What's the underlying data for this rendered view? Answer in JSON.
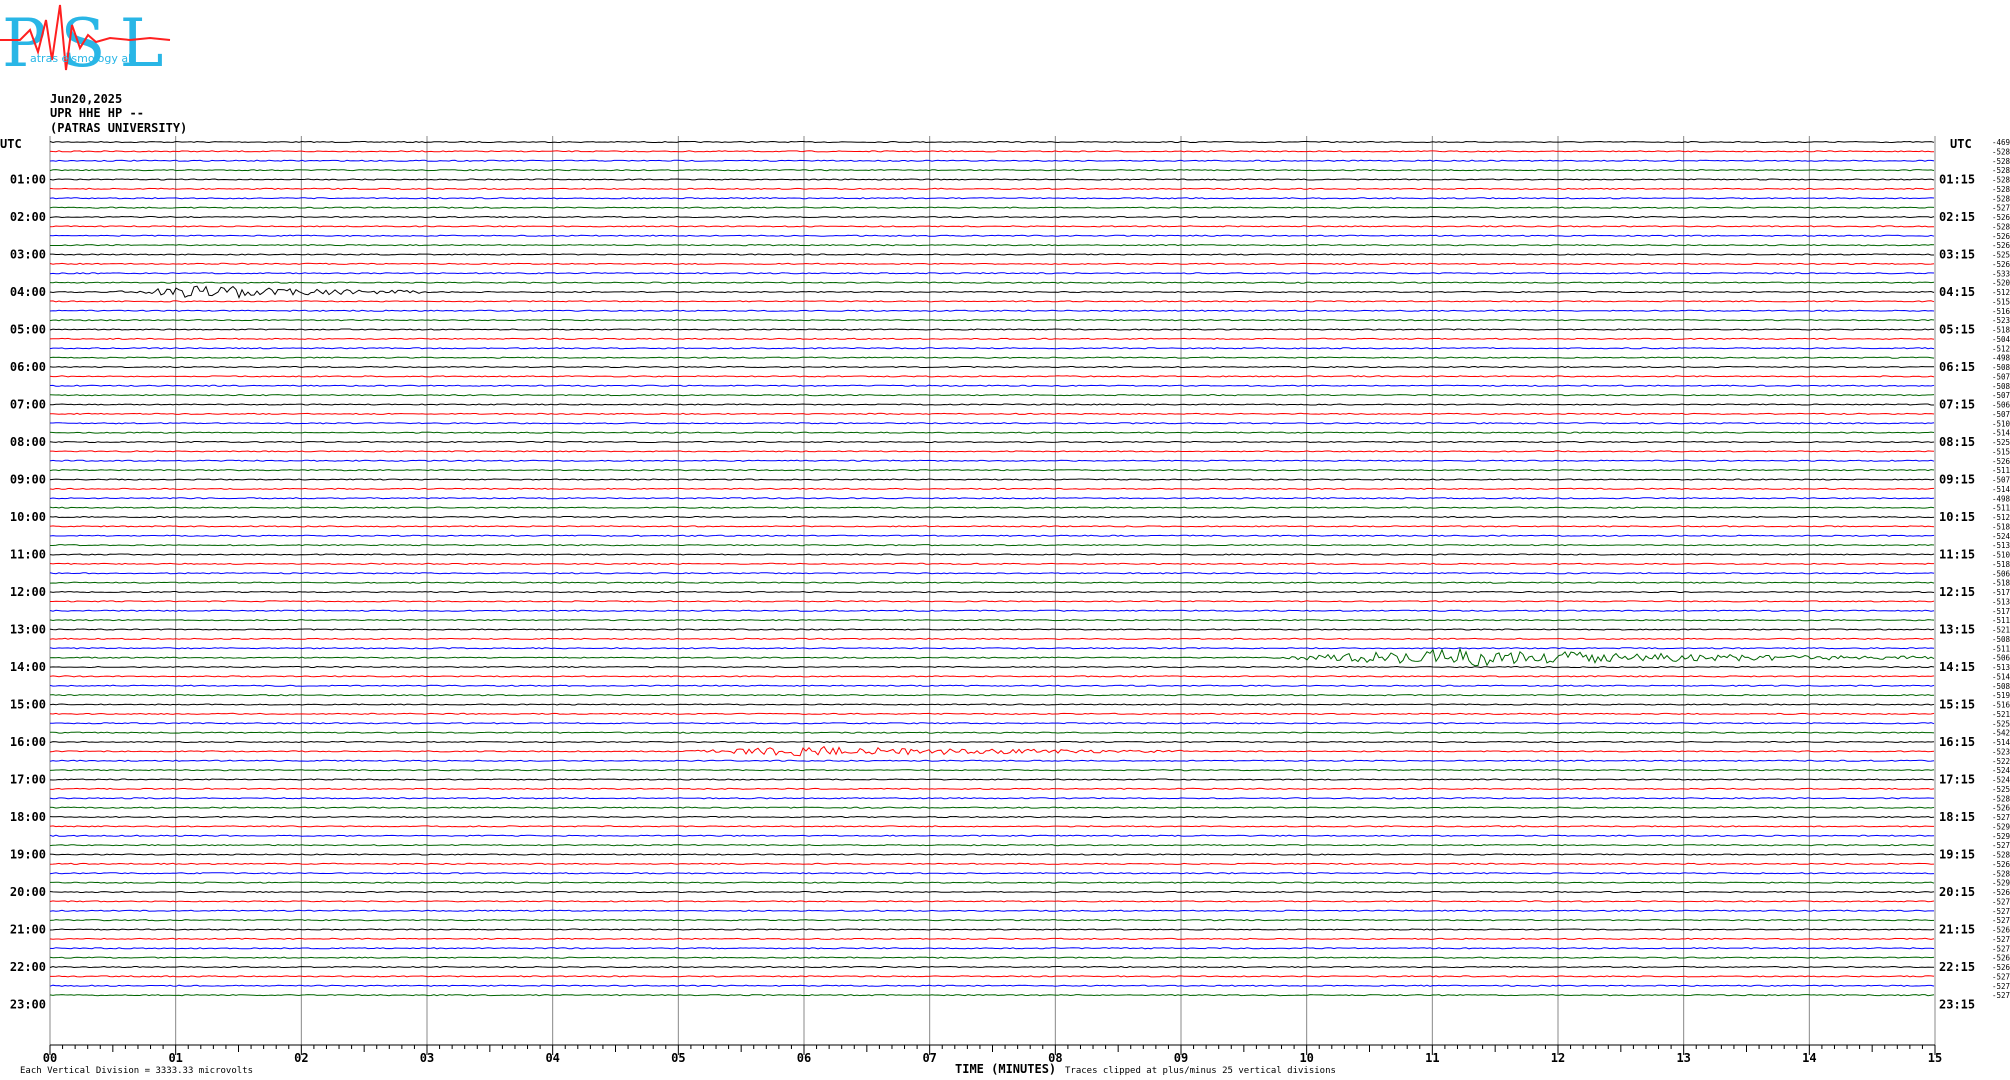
{
  "header": {
    "date": "Jun20,2025",
    "station": "UPR HHE HP --",
    "institution": "(PATRAS UNIVERSITY)",
    "logo_text": "PSL",
    "logo_sub": "atras eismology ab"
  },
  "axes": {
    "utc_left": "UTC",
    "utc_right": "UTC",
    "xlabel": "TIME (MINUTES)",
    "footer_left": "Each Vertical Division = 3333.33 microvolts",
    "footer_right": "Traces clipped at plus/minus 25 vertical divisions"
  },
  "colors": {
    "black": "#000000",
    "red": "#ff0000",
    "blue": "#0000ff",
    "green": "#006400",
    "grid": "#888888"
  },
  "chart_data": {
    "type": "line",
    "title": "",
    "x_ticks": [
      "00",
      "01",
      "02",
      "03",
      "04",
      "05",
      "06",
      "07",
      "08",
      "09",
      "10",
      "11",
      "12",
      "13",
      "14",
      "15"
    ],
    "xlim": [
      0,
      15
    ],
    "left_hour_labels": [
      "01:00",
      "02:00",
      "03:00",
      "04:00",
      "05:00",
      "06:00",
      "07:00",
      "08:00",
      "09:00",
      "10:00",
      "11:00",
      "12:00",
      "13:00",
      "14:00",
      "15:00",
      "16:00",
      "17:00",
      "18:00",
      "19:00",
      "20:00",
      "21:00",
      "22:00",
      "23:00"
    ],
    "right_hour_labels": [
      "01:15",
      "02:15",
      "03:15",
      "04:15",
      "05:15",
      "06:15",
      "07:15",
      "08:15",
      "09:15",
      "10:15",
      "11:15",
      "12:15",
      "13:15",
      "14:15",
      "15:15",
      "16:15",
      "17:15",
      "18:15",
      "19:15",
      "20:15",
      "21:15",
      "22:15",
      "23:15"
    ],
    "trace_offsets": [
      "-4691",
      "-5284",
      "-5284",
      "-5286",
      "-5287",
      "-5285",
      "-5282",
      "-5277",
      "-5260",
      "-5288",
      "-5265",
      "-5264",
      "-5255",
      "-5260",
      "-5331",
      "-5207",
      "-5121",
      "-5152",
      "-5169",
      "-5232",
      "-5185",
      "-5048",
      "-5129",
      "-4981",
      "-5086",
      "-5074",
      "-5087",
      "-5078",
      "-5064",
      "-5071",
      "-5109",
      "-5146",
      "-5256",
      "-5150",
      "-5264",
      "-5118",
      "-5076",
      "-5140",
      "-4982",
      "-5112",
      "-5128",
      "-5189",
      "-5247",
      "-5136",
      "-5108",
      "-5185",
      "-5064",
      "-5180",
      "-5171",
      "-5137",
      "-5171",
      "-5111",
      "-5213",
      "-5085",
      "-5117",
      "-5067",
      "-5131",
      "-5141",
      "-5086",
      "-5193",
      "-5164",
      "-5214",
      "-5255",
      "-5421",
      "-5145",
      "-5239",
      "-5227",
      "-5248",
      "-5242",
      "-5254",
      "-5287",
      "-5267",
      "-5273",
      "-5295",
      "-5290",
      "-5273",
      "-5281",
      "-5263",
      "-5282",
      "-5293",
      "-5266",
      "-5276",
      "-5274",
      "-5276",
      "-5261",
      "-5272",
      "-5279",
      "-5263",
      "-5267",
      "-5275",
      "-5273",
      "-5277"
    ],
    "trace_color_cycle": [
      "black",
      "red",
      "blue",
      "green"
    ],
    "events": [
      {
        "trace": 16,
        "start_min": 0.5,
        "end_min": 3.0,
        "amp": 14
      },
      {
        "trace": 65,
        "start_min": 5.0,
        "end_min": 9.0,
        "amp": 10
      },
      {
        "trace": 55,
        "start_min": 9.7,
        "end_min": 15.0,
        "amp": 18
      }
    ]
  }
}
